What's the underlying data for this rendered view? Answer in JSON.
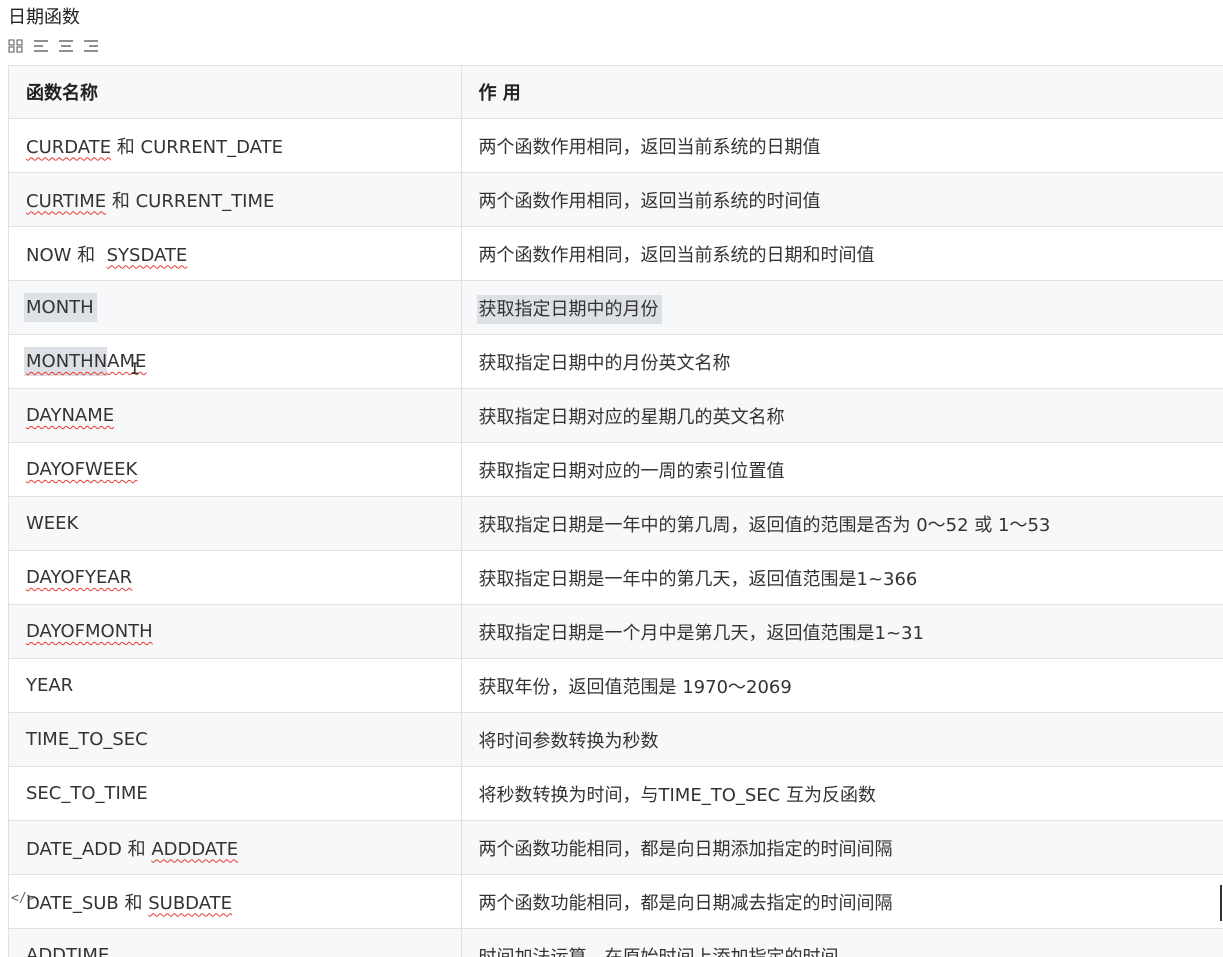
{
  "title": "日期函数",
  "toolbar": {
    "icons": [
      "grid-icon",
      "align-left-icon",
      "align-center-icon",
      "align-right-icon"
    ]
  },
  "table": {
    "headers": [
      "函数名称",
      "作 用"
    ],
    "rows": [
      {
        "func_a": "CURDATE",
        "func_b": " 和 CURRENT_DATE",
        "desc": "两个函数作用相同，返回当前系统的日期值"
      },
      {
        "func_a": "CURTIME",
        "func_b": " 和 CURRENT_TIME",
        "desc": "两个函数作用相同，返回当前系统的时间值"
      },
      {
        "func_a": "NOW 和  ",
        "func_b": "SYSDATE",
        "desc": "两个函数作用相同，返回当前系统的日期和时间值"
      },
      {
        "func": "MONTH",
        "desc": "获取指定日期中的月份"
      },
      {
        "func_a": "MONTHN",
        "func_b": "AME",
        "desc": "获取指定日期中的月份英文名称"
      },
      {
        "func": "DAYNAME",
        "desc": "获取指定日期对应的星期几的英文名称"
      },
      {
        "func": "DAYOFWEEK",
        "desc": "获取指定日期对应的一周的索引位置值"
      },
      {
        "func": "WEEK",
        "desc": "获取指定日期是一年中的第几周，返回值的范围是否为 0〜52 或 1〜53"
      },
      {
        "func": "DAYOFYEAR",
        "desc": "获取指定日期是一年中的第几天，返回值范围是1~366"
      },
      {
        "func": "DAYOFMONTH",
        "desc": "获取指定日期是一个月中是第几天，返回值范围是1~31"
      },
      {
        "func": "YEAR",
        "desc": "获取年份，返回值范围是 1970〜2069"
      },
      {
        "func": "TIME_TO_SEC",
        "desc": "将时间参数转换为秒数"
      },
      {
        "func": "SEC_TO_TIME",
        "desc": "将秒数转换为时间，与TIME_TO_SEC 互为反函数"
      },
      {
        "func_a": "DATE_ADD 和 ",
        "func_b": "ADDDATE",
        "desc": "两个函数功能相同，都是向日期添加指定的时间间隔"
      },
      {
        "func_a": "DATE_SUB 和 ",
        "func_b": "SUBDATE",
        "desc": "两个函数功能相同，都是向日期减去指定的时间间隔"
      },
      {
        "func": "ADDTIME",
        "desc": "时间加法运算，在原始时间上添加指定的时间"
      }
    ]
  },
  "code_icon_glyph": "</>",
  "colors": {
    "border": "#dfe2e5",
    "stripe": "#f7f8f9",
    "selection": "#dde1e5",
    "spellcheck": "#e53935"
  }
}
